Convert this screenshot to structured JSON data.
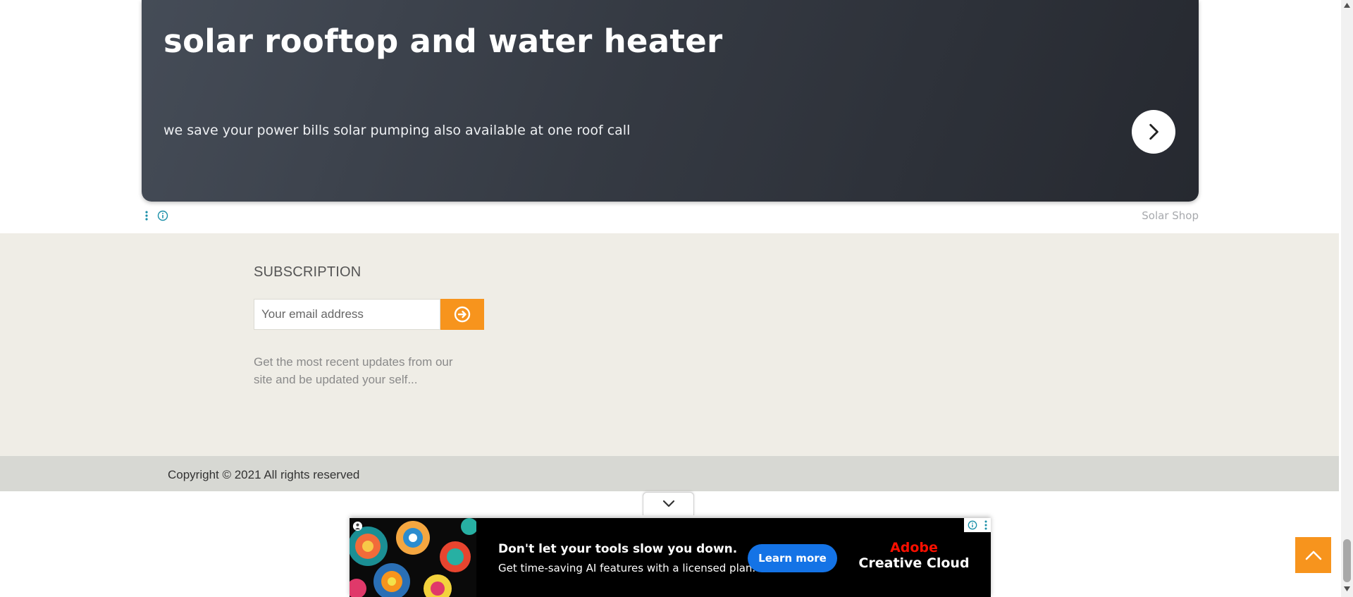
{
  "promo_ad": {
    "title": "solar rooftop and water heater",
    "subtitle": "we save your power bills solar pumping also available at one roof call",
    "arrow_icon": "chevron-right-icon",
    "sponsor": "Solar Shop"
  },
  "subscription": {
    "heading": "SUBSCRIPTION",
    "email_placeholder": "Your email address",
    "submit_icon": "circle-arrow-right-icon",
    "description": "Get the most recent updates from our site and be updated your self..."
  },
  "copyright": {
    "text": "Copyright © 2021 All rights reserved"
  },
  "bottom_ad": {
    "headline": "Don't let your tools slow you down.",
    "body": "Get time-saving AI features with a licensed plan.",
    "cta": "Learn more",
    "brand_line1": "Adobe",
    "brand_line2": "Creative Cloud"
  },
  "colors": {
    "accent_orange": "#f7941d",
    "footer_bg": "#efede6",
    "copyright_bg": "#d7d8d3",
    "banner_dark": "#2a2d34",
    "cta_blue": "#1473e6",
    "brand_red": "#fa0f00"
  }
}
